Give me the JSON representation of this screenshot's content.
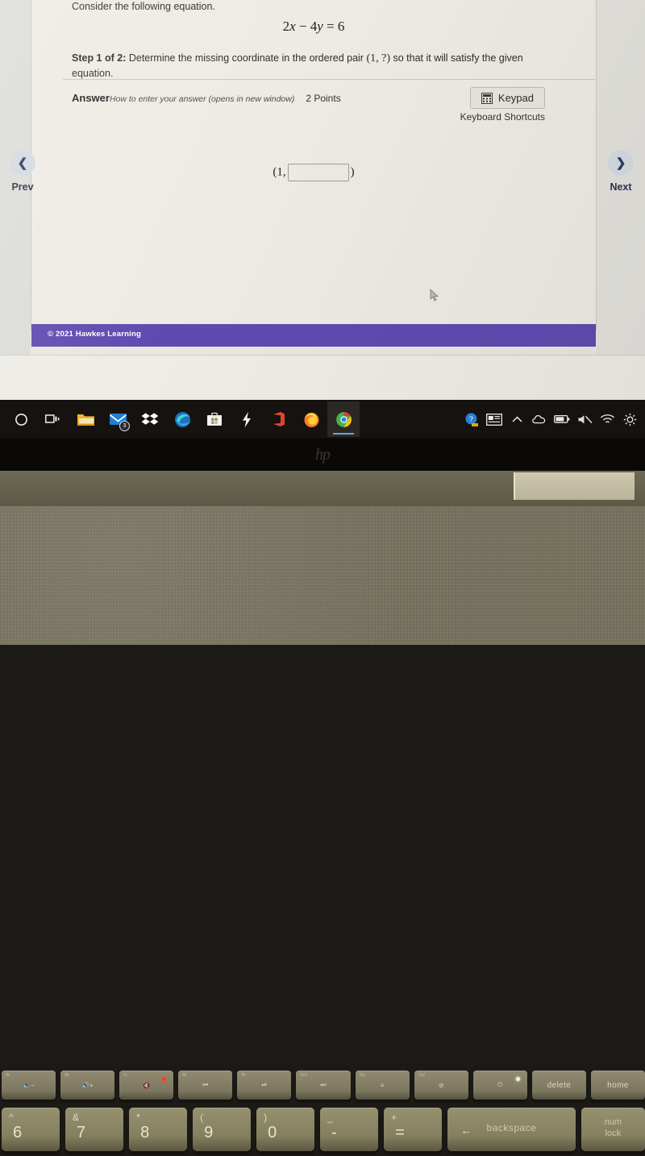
{
  "screen": {
    "question": {
      "prompt": "Consider the following equation.",
      "equation_lhs_a": "2",
      "equation_var_x": "x",
      "equation_op": " − ",
      "equation_lhs_b": "4",
      "equation_var_y": "y",
      "equation_eq": " = ",
      "equation_rhs": "6",
      "equation_plain": "2x − 4y = 6",
      "step_label": "Step 1 of 2:",
      "step_text_before": " Determine the missing coordinate in the ordered pair ",
      "step_pair": "(1, ?)",
      "step_text_after": " so that it will satisfy the given equation."
    },
    "answer": {
      "label": "Answer",
      "how_link": "How to enter your answer (opens in new window)",
      "points": "2 Points",
      "keypad_label": "Keypad",
      "keypad_icon": "calculator-icon",
      "keyboard_shortcuts": "Keyboard Shortcuts",
      "pair_open": "(1,",
      "pair_close": ")",
      "input_value": "",
      "input_placeholder": ""
    },
    "nav": {
      "prev_label": "Prev",
      "prev_icon": "chevron-left-icon",
      "next_label": "Next",
      "next_icon": "chevron-right-icon"
    },
    "footer": {
      "copyright": "© 2021 Hawkes Learning",
      "bar_color": "#5f4bb0"
    },
    "cursor_icon": "mouse-pointer-icon"
  },
  "taskbar": {
    "items": [
      {
        "name": "cortana-icon",
        "label": "Cortana"
      },
      {
        "name": "task-view-icon",
        "label": "Task View"
      },
      {
        "name": "file-explorer-icon",
        "label": "File Explorer"
      },
      {
        "name": "mail-icon",
        "label": "Mail",
        "badge": "3"
      },
      {
        "name": "dropbox-icon",
        "label": "Dropbox"
      },
      {
        "name": "edge-icon",
        "label": "Microsoft Edge"
      },
      {
        "name": "store-icon",
        "label": "Microsoft Store"
      },
      {
        "name": "lightning-icon",
        "label": "Lightning"
      },
      {
        "name": "office-icon",
        "label": "Office"
      },
      {
        "name": "firefox-icon",
        "label": "Firefox"
      },
      {
        "name": "chrome-icon",
        "label": "Google Chrome",
        "active": true
      }
    ],
    "tray": [
      {
        "name": "weather-help-icon",
        "label": "Weather"
      },
      {
        "name": "news-icon",
        "label": "News and interests"
      },
      {
        "name": "show-hidden-icons-icon",
        "label": "Show hidden icons"
      },
      {
        "name": "onedrive-icon",
        "label": "OneDrive"
      },
      {
        "name": "battery-icon",
        "label": "Battery"
      },
      {
        "name": "speaker-muted-icon",
        "label": "Volume muted"
      },
      {
        "name": "wifi-icon",
        "label": "Network"
      },
      {
        "name": "settings-icon",
        "label": "Settings"
      }
    ]
  },
  "laptop": {
    "brand_logo": "hp",
    "function_keys": [
      {
        "num": "f5",
        "glyph": "🔈−",
        "label": "",
        "led": ""
      },
      {
        "num": "f6",
        "glyph": "🔊+",
        "label": "",
        "led": ""
      },
      {
        "num": "f7",
        "glyph": "🔇",
        "label": "",
        "led": "red"
      },
      {
        "num": "f8",
        "glyph": "⏮",
        "label": "",
        "led": ""
      },
      {
        "num": "f9",
        "glyph": "⏯",
        "label": "",
        "led": ""
      },
      {
        "num": "f10",
        "glyph": "⏭",
        "label": "",
        "led": ""
      },
      {
        "num": "f11",
        "glyph": "≡",
        "label": "",
        "led": ""
      },
      {
        "num": "f12",
        "glyph": "⊘",
        "label": "",
        "led": ""
      },
      {
        "num": "",
        "glyph": "⏻",
        "label": "",
        "led": "white"
      },
      {
        "num": "",
        "glyph": "",
        "label": "delete",
        "led": ""
      },
      {
        "num": "",
        "glyph": "",
        "label": "home",
        "led": ""
      }
    ],
    "number_keys": [
      {
        "sym": "^",
        "digit": "6"
      },
      {
        "sym": "&",
        "digit": "7"
      },
      {
        "sym": "*",
        "digit": "8"
      },
      {
        "sym": "(",
        "digit": "9"
      },
      {
        "sym": ")",
        "digit": "0"
      },
      {
        "sym": "_",
        "digit": "-"
      },
      {
        "sym": "+",
        "digit": "="
      },
      {
        "sym": "",
        "digit": "",
        "wide": "backspace",
        "arrow": "←"
      },
      {
        "sym": "",
        "digit": "",
        "two_line": "num\nlock"
      }
    ]
  }
}
